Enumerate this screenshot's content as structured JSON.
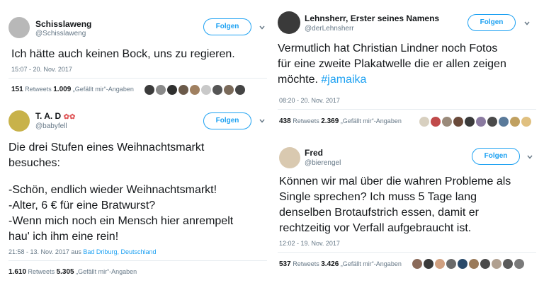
{
  "tweets": [
    {
      "name": "Schisslaweng",
      "handle": "@Schisslaweng",
      "follow": "Folgen",
      "text_lines": [
        "Ich hätte auch keinen Bock, uns zu regieren."
      ],
      "time": "15:07 - 20. Nov. 2017",
      "retweets_count": "151",
      "retweets_label": "Retweets",
      "likes_count": "1.009",
      "likes_label": "„Gefällt mir“-Angaben",
      "avatar_color": "#b8b8b8"
    },
    {
      "name": "T. A. D",
      "handle": "@babyfell",
      "follow": "Folgen",
      "text_lines": [
        "Die drei Stufen eines Weihnachtsmarkt",
        "besuches:",
        "",
        "-Schön, endlich wieder Weihnachtsmarkt!",
        "-Alter, 6 € für eine Bratwurst?",
        "-Wenn mich noch ein Mensch hier anrempelt",
        "hau' ich ihm eine rein!"
      ],
      "time": "21:58 - 13. Nov. 2017 aus",
      "location": "Bad Driburg, Deutschland",
      "retweets_count": "1.610",
      "retweets_label": "Retweets",
      "likes_count": "5.305",
      "likes_label": "„Gefällt mir“-Angaben",
      "avatar_color": "#c8b24a"
    },
    {
      "name": "Lehnsherr, Erster seines Namens",
      "handle": "@derLehnsherr",
      "follow": "Folgen",
      "text_lines": [
        "Vermutlich hat Christian Lindner noch Fotos",
        "für eine zweite Plakatwelle die er allen zeigen",
        "möchte."
      ],
      "hashtag": "#jamaika",
      "time": "08:20 - 20. Nov. 2017",
      "retweets_count": "438",
      "retweets_label": "Retweets",
      "likes_count": "2.369",
      "likes_label": "„Gefällt mir“-Angaben",
      "avatar_color": "#3a3a3a"
    },
    {
      "name": "Fred",
      "handle": "@bierengel",
      "follow": "Folgen",
      "text_lines": [
        "Können wir mal über die wahren Probleme als",
        "Single sprechen? Ich muss 5 Tage lang",
        "denselben Brotaufstrich essen, damit er",
        "rechtzeitig vor Verfall aufgebraucht ist."
      ],
      "time": "12:02 - 19. Nov. 2017",
      "retweets_count": "537",
      "retweets_label": "Retweets",
      "likes_count": "3.426",
      "likes_label": "„Gefällt mir“-Angaben",
      "avatar_color": "#d9c9b0"
    }
  ],
  "face_colors": {
    "t0": [
      "#3b3b3b",
      "#8a8a8a",
      "#2f2f2f",
      "#6b5a4a",
      "#a08060",
      "#c9c9c9",
      "#555555",
      "#7a6a5a",
      "#444444"
    ],
    "t1": [],
    "t2": [
      "#d8d0c0",
      "#c04a4a",
      "#9a8a7a",
      "#6a4a3a",
      "#3a3a3a",
      "#8a7aa0",
      "#4a4a4a",
      "#5a7a9a",
      "#c0a060",
      "#e0c080"
    ],
    "t3": [
      "#8a6a5a",
      "#3a3a3a",
      "#d0a080",
      "#6a6a6a",
      "#2a4a6a",
      "#9a7a5a",
      "#4a4a4a",
      "#b0a090",
      "#5a5a5a",
      "#7a7a7a"
    ]
  }
}
